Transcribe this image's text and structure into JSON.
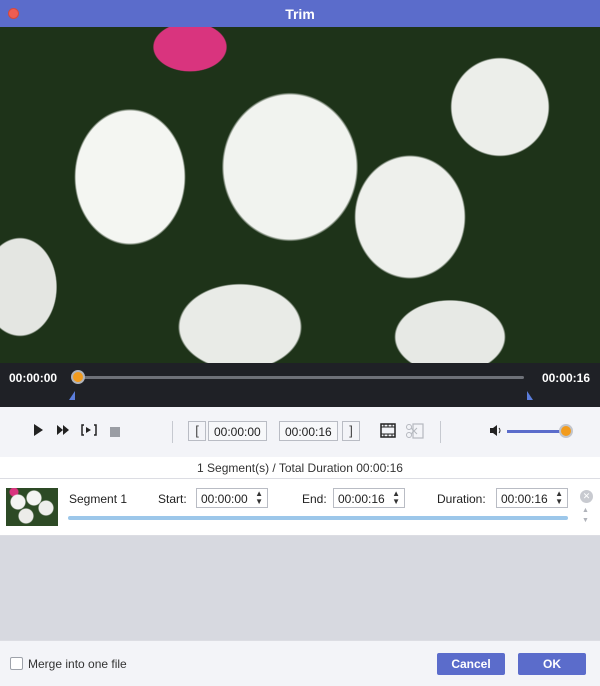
{
  "window": {
    "title": "Trim"
  },
  "timeline": {
    "start_time": "00:00:00",
    "end_time": "00:00:16",
    "playhead_position": 0.0
  },
  "controls": {
    "play_icon": "play-icon",
    "fast_forward_icon": "fast-forward-icon",
    "step_icon": "step-frame-icon",
    "stop_icon": "stop-icon",
    "set_start_bracket": "[",
    "start_time": "00:00:00",
    "end_time": "00:00:16",
    "set_end_bracket": "]",
    "volume_level": 1.0
  },
  "segments": {
    "summary": "1 Segment(s) / Total Duration 00:00:16",
    "items": [
      {
        "name": "Segment 1",
        "start_label": "Start:",
        "start": "00:00:00",
        "end_label": "End:",
        "end": "00:00:16",
        "duration_label": "Duration:",
        "duration": "00:00:16"
      }
    ]
  },
  "footer": {
    "merge_label": "Merge into one file",
    "merge_checked": false,
    "cancel_label": "Cancel",
    "ok_label": "OK"
  },
  "colors": {
    "accent": "#5b6ccb",
    "playhead": "#f29b1d",
    "timeline_bg": "#1f2126"
  }
}
